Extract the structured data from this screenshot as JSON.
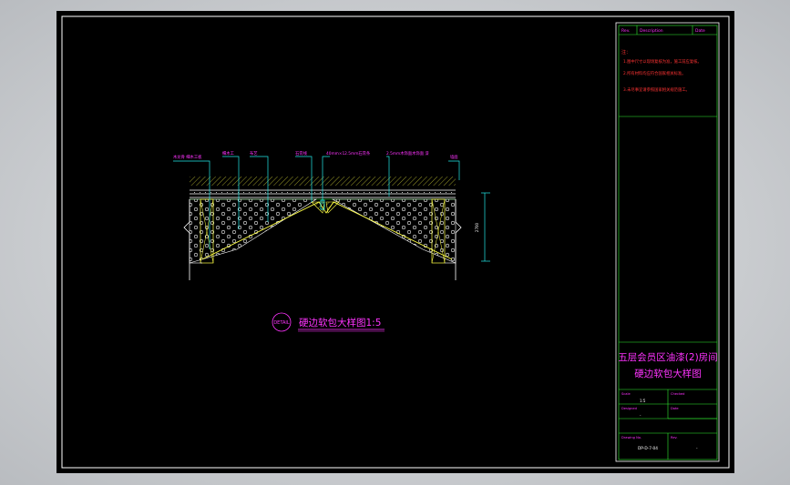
{
  "drawing": {
    "labels": [
      "木龙骨 细木工板",
      "细木工",
      "布艺",
      "石膏线",
      "40mm×12.5mm石膏条",
      "2.5mm木饰面木饰面 漆",
      "墙面"
    ],
    "dimension": "2700",
    "detail_tag": "DETAIL",
    "caption": "硬边软包大样图1:5"
  },
  "title_block": {
    "header": [
      "Rev.",
      "Description",
      "Date"
    ],
    "notes_title": "注：",
    "notes": [
      "1.图中尺寸以现场复核为准，施工前应复核。",
      "2.所有材料均应符合国家相关标准。",
      "3.未尽事宜请参照国家相关规范施工。"
    ],
    "project_name": "五层会员区油漆(2)房间",
    "drawing_name": "硬边软包大样图",
    "fields": [
      {
        "label": "Scale",
        "value": "1:5",
        "label2": "Checked",
        "value2": ""
      },
      {
        "label": "Designed",
        "value": "-",
        "label2": "Date",
        "value2": ""
      },
      {
        "label": "Drawing No.",
        "value": "DP-D-7-04",
        "label2": "Rev.",
        "value2": "-"
      }
    ]
  },
  "colors": {
    "magenta": "#ff33ff",
    "cyan": "#22e8e8",
    "green": "#33ee33",
    "red": "#ff3333",
    "yellow": "#ffff44",
    "white": "#ffffff"
  }
}
